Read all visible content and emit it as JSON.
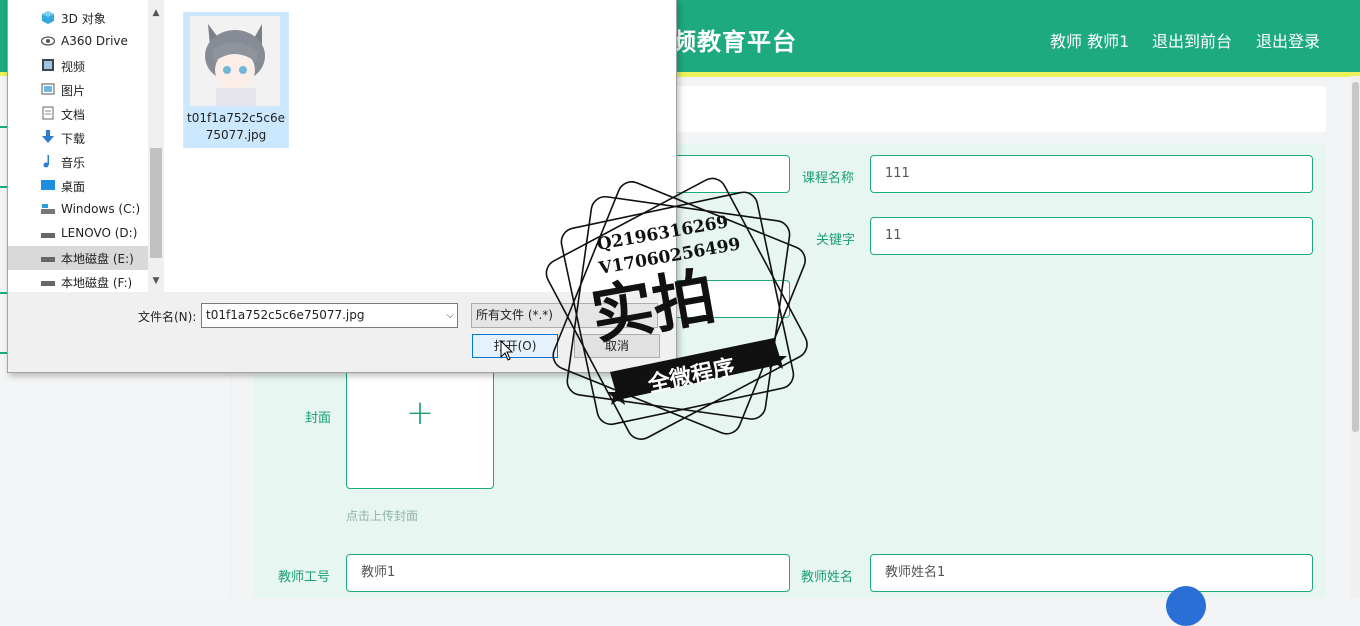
{
  "header": {
    "brand": "频教育平台",
    "nav": [
      "教师 教师1",
      "退出到前台",
      "退出登录"
    ]
  },
  "form": {
    "course_name_label": "课程名称",
    "course_name_value": "111",
    "keyword_label": "关键字",
    "keyword_value": "11",
    "cover_label": "封面",
    "upload_plus": "+",
    "upload_hint": "点击上传封面",
    "teacher_id_label": "教师工号",
    "teacher_id_value": "教师1",
    "teacher_name_label": "教师姓名",
    "teacher_name_value": "教师姓名1"
  },
  "dialog": {
    "nav_items": [
      {
        "label": "3D 对象",
        "icon": "cube-icon"
      },
      {
        "label": "A360 Drive",
        "icon": "eye-icon"
      },
      {
        "label": "视频",
        "icon": "video-icon"
      },
      {
        "label": "图片",
        "icon": "picture-icon"
      },
      {
        "label": "文档",
        "icon": "document-icon"
      },
      {
        "label": "下载",
        "icon": "download-icon"
      },
      {
        "label": "音乐",
        "icon": "music-icon"
      },
      {
        "label": "桌面",
        "icon": "desktop-icon"
      },
      {
        "label": "Windows (C:)",
        "icon": "drive-icon"
      },
      {
        "label": "LENOVO (D:)",
        "icon": "drive-icon"
      },
      {
        "label": "本地磁盘 (E:)",
        "icon": "drive-icon"
      },
      {
        "label": "本地磁盘 (F:)",
        "icon": "drive-icon"
      }
    ],
    "selected_nav_index": 10,
    "file_name": "t01f1a752c5c6e75077.jpg",
    "filename_label": "文件名(N):",
    "filename_value": "t01f1a752c5c6e75077.jpg",
    "filetype_value": "所有文件 (*.*)",
    "open_button": "打开(O)",
    "cancel_button": "取消"
  },
  "watermark": {
    "line1": "Q2196316269",
    "line2": "V17060256499",
    "main": "实拍",
    "ribbon": "全微程序"
  }
}
